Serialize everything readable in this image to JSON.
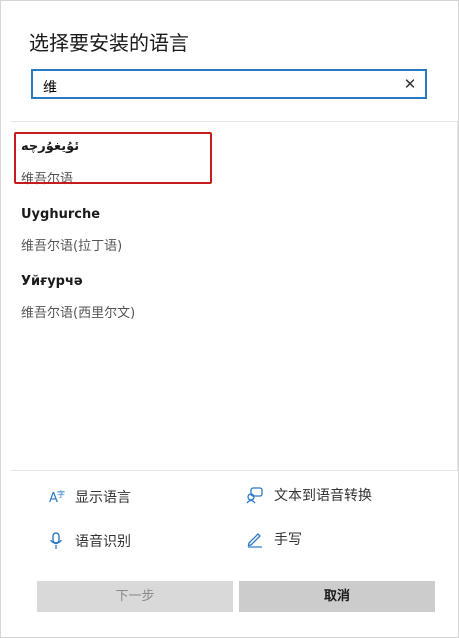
{
  "dialog": {
    "title": "选择要安装的语言"
  },
  "search": {
    "value": "维"
  },
  "results": [
    {
      "name": "ئۇيغۇرچە",
      "sub": "维吾尔语"
    },
    {
      "name": "Uyghurche",
      "sub": "维吾尔语(拉丁语)"
    },
    {
      "name": "Уйғурчә",
      "sub": "维吾尔语(西里尔文)"
    }
  ],
  "features": [
    {
      "label": "显示语言",
      "icon": "display-language-icon"
    },
    {
      "label": "文本到语音转换",
      "icon": "text-to-speech-icon"
    },
    {
      "label": "语音识别",
      "icon": "microphone-icon"
    },
    {
      "label": "手写",
      "icon": "handwriting-pen-icon"
    }
  ],
  "buttons": {
    "next": "下一步",
    "cancel": "取消"
  },
  "colors": {
    "accent": "#2b78c7",
    "highlight": "#c81b1b"
  }
}
